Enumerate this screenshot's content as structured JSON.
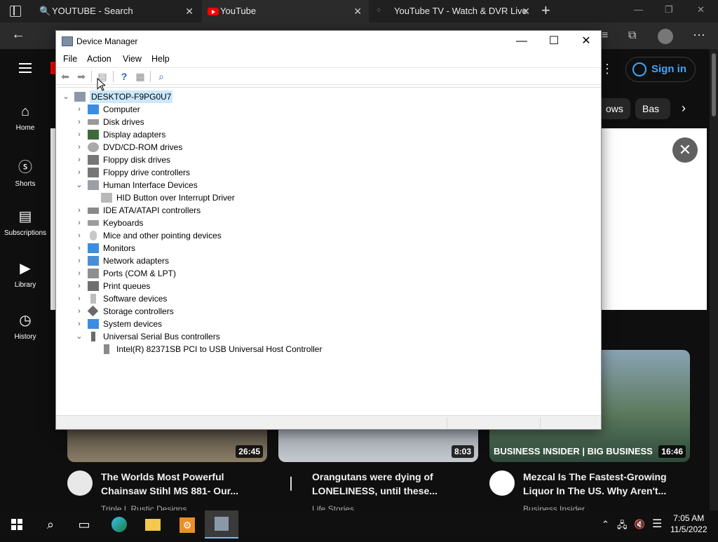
{
  "browser": {
    "tabs": [
      {
        "label": "YOUTUBE - Search",
        "close": "✕"
      },
      {
        "label": "YouTube",
        "close": "✕"
      },
      {
        "label": "YouTube TV - Watch & DVR Live",
        "close": "✕"
      }
    ],
    "new_tab": "+",
    "win_minimize": "—",
    "win_restore": "❐",
    "win_close": "✕",
    "back": "←",
    "more": "⋯"
  },
  "youtube": {
    "nav": [
      {
        "label": "Home",
        "icon": "home-icon"
      },
      {
        "label": "Shorts",
        "icon": "shorts-icon"
      },
      {
        "label": "Subscriptions",
        "icon": "subscriptions-icon"
      },
      {
        "label": "Library",
        "icon": "library-icon"
      },
      {
        "label": "History",
        "icon": "history-icon"
      }
    ],
    "signin": "Sign in",
    "chips": [
      "ows",
      "Bas"
    ],
    "close": "✕",
    "videos": [
      {
        "title": "The Worlds Most Powerful Chainsaw Stihl MS 881- Our...",
        "channel": "Triple L Rustic Designs",
        "duration": "26:45"
      },
      {
        "title": "Orangutans were dying of LONELINESS, until these...",
        "channel": "Life Stories",
        "duration": "8:03"
      },
      {
        "title": "Mezcal Is The Fastest-Growing Liquor In The US. Why Aren't...",
        "channel": "Business Insider",
        "duration": "16:46",
        "thumb_text": "BUSINESS INSIDER | BIG BUSINESS"
      }
    ]
  },
  "device_manager": {
    "title": "Device Manager",
    "minimize": "—",
    "maximize": "☐",
    "close": "✕",
    "menu": [
      "File",
      "Action",
      "View",
      "Help"
    ],
    "tree": [
      {
        "label": "DESKTOP-F9PG0U7",
        "chev": "⌄",
        "level": 0
      },
      {
        "label": "Computer",
        "chev": "›",
        "level": 1
      },
      {
        "label": "Disk drives",
        "chev": "›",
        "level": 1
      },
      {
        "label": "Display adapters",
        "chev": "›",
        "level": 1
      },
      {
        "label": "DVD/CD-ROM drives",
        "chev": "›",
        "level": 1
      },
      {
        "label": "Floppy disk drives",
        "chev": "›",
        "level": 1
      },
      {
        "label": "Floppy drive controllers",
        "chev": "›",
        "level": 1
      },
      {
        "label": "Human Interface Devices",
        "chev": "⌄",
        "level": 1
      },
      {
        "label": "HID Button over Interrupt Driver",
        "chev": "",
        "level": 2,
        "warning": true
      },
      {
        "label": "IDE ATA/ATAPI controllers",
        "chev": "›",
        "level": 1
      },
      {
        "label": "Keyboards",
        "chev": "›",
        "level": 1
      },
      {
        "label": "Mice and other pointing devices",
        "chev": "›",
        "level": 1
      },
      {
        "label": "Monitors",
        "chev": "›",
        "level": 1
      },
      {
        "label": "Network adapters",
        "chev": "›",
        "level": 1
      },
      {
        "label": "Ports (COM & LPT)",
        "chev": "›",
        "level": 1
      },
      {
        "label": "Print queues",
        "chev": "›",
        "level": 1
      },
      {
        "label": "Software devices",
        "chev": "›",
        "level": 1
      },
      {
        "label": "Storage controllers",
        "chev": "›",
        "level": 1
      },
      {
        "label": "System devices",
        "chev": "›",
        "level": 1
      },
      {
        "label": "Universal Serial Bus controllers",
        "chev": "⌄",
        "level": 1
      },
      {
        "label": "Intel(R) 82371SB PCI to USB Universal Host Controller",
        "chev": "",
        "level": 2,
        "warning": true
      }
    ]
  },
  "taskbar": {
    "time": "7:05 AM",
    "date": "11/5/2022"
  }
}
